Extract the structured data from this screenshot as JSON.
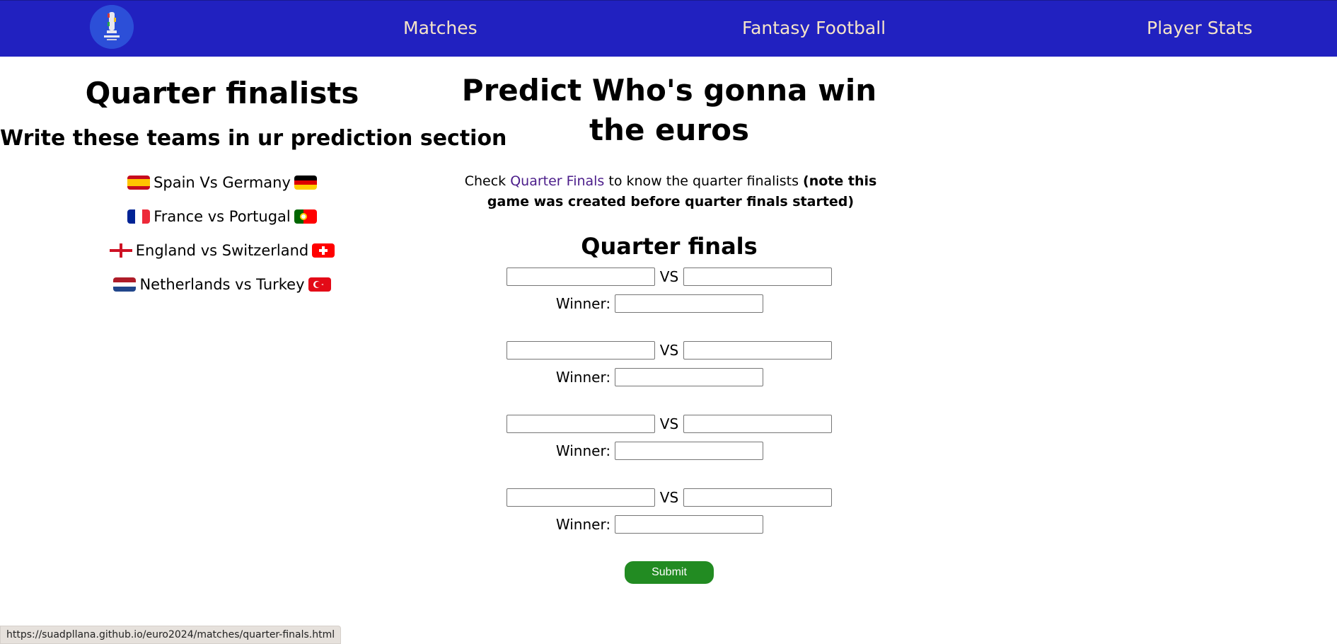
{
  "nav": {
    "logo_alt": "EURO 2024",
    "items": [
      {
        "label": "Matches"
      },
      {
        "label": "Fantasy Football"
      },
      {
        "label": "Player Stats"
      }
    ]
  },
  "left": {
    "title": "Quarter finalists",
    "subtitle": "Write these teams in ur prediction section",
    "matchups": [
      {
        "text": "Spain Vs Germany",
        "flag_left": "spain-flag",
        "flag_right": "germany-flag"
      },
      {
        "text": "France vs Portugal",
        "flag_left": "france-flag",
        "flag_right": "portugal-flag"
      },
      {
        "text": "England vs Switzerland",
        "flag_left": "england-flag",
        "flag_right": "switzerland-flag"
      },
      {
        "text": "Netherlands vs Turkey",
        "flag_left": "netherlands-flag",
        "flag_right": "turkey-flag"
      }
    ]
  },
  "center": {
    "title": "Predict Who's gonna win the euros",
    "check_prefix": "Check ",
    "check_link": "Quarter Finals",
    "check_middle": " to know the quarter finalists ",
    "check_note": "(note this game was created before quarter finals started)",
    "section_title": "Quarter finals",
    "vs_label": "VS",
    "winner_label": "Winner:",
    "matches": [
      {
        "team1": "",
        "team2": "",
        "winner": ""
      },
      {
        "team1": "",
        "team2": "",
        "winner": ""
      },
      {
        "team1": "",
        "team2": "",
        "winner": ""
      },
      {
        "team1": "",
        "team2": "",
        "winner": ""
      }
    ],
    "submit_label": "Submit"
  },
  "status_bar": {
    "url": "https://suadpllana.github.io/euro2024/matches/quarter-finals.html"
  },
  "colors": {
    "navbar": "#2121c0",
    "nav_text": "#f5e4c8",
    "link": "#4b1d8a",
    "submit": "#228b22"
  }
}
